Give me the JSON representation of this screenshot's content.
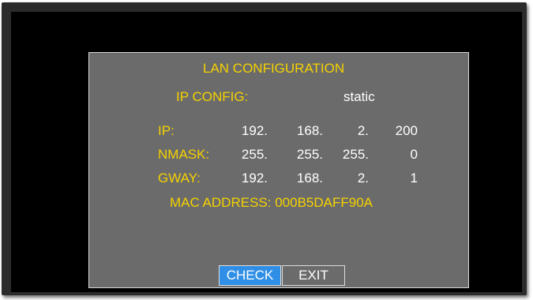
{
  "dialog": {
    "title": "LAN CONFIGURATION",
    "ip_config_label": "IP CONFIG:",
    "ip_config_value": "static",
    "rows": [
      {
        "label": "IP:",
        "octets": [
          "192.",
          "168.",
          "2.",
          "200"
        ]
      },
      {
        "label": "NMASK:",
        "octets": [
          "255.",
          "255.",
          "255.",
          "0"
        ]
      },
      {
        "label": "GWAY:",
        "octets": [
          "192.",
          "168.",
          "2.",
          "1"
        ]
      }
    ],
    "mac_label": "MAC ADDRESS:",
    "mac_value": "000B5DAFF90A",
    "buttons": {
      "check": "CHECK",
      "exit": "EXIT"
    }
  },
  "colors": {
    "label": "#f5d200",
    "value": "#ffffff",
    "panel_bg": "#6b6b6b",
    "selected_button": "#2f8fe6",
    "screen_bg": "#000000"
  }
}
